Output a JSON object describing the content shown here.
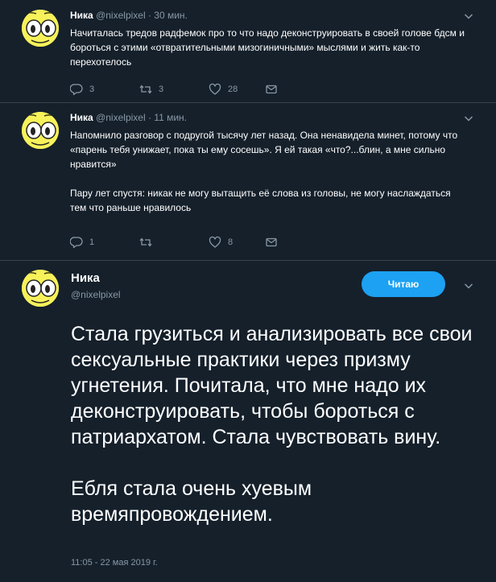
{
  "tweets": [
    {
      "name": "Ника",
      "handle": "@nixelpixel",
      "time": "· 30 мин.",
      "text": "Начиталась тредов радфемок про то что надо деконструировать в своей голове бдсм и бороться с этими «отвратительными мизогиничными» мыслями и жить как-то перехотелось",
      "replies": "3",
      "retweets": "3",
      "likes": "28"
    },
    {
      "name": "Ника",
      "handle": "@nixelpixel",
      "time": "· 11 мин.",
      "text1": "Напомнило разговор с подругой тысячу лет назад. Она ненавидела минет, потому что «парень тебя унижает, пока ты ему сосешь». Я ей такая «что?...блин, а мне сильно нравится»",
      "text2": "Пару лет спустя: никак не могу вытащить её слова из головы, не могу наслаждаться тем что раньше нравилось",
      "replies": "1",
      "retweets": "",
      "likes": "8"
    }
  ],
  "main_tweet": {
    "name": "Ника",
    "handle": "@nixelpixel",
    "follow_label": "Читаю",
    "text1": "Стала грузиться и анализировать все свои сексуальные практики через призму угнетения. Почитала, что мне надо их деконструировать, чтобы бороться с патриархатом. Стала чувствовать вину.",
    "text2": "Ебля стала очень хуевым времяпровождением.",
    "timestamp": "11:05 - 22 мая 2019 г."
  },
  "icons": {
    "reply": "reply-icon",
    "retweet": "retweet-icon",
    "like": "heart-icon",
    "dm": "direct-message-icon",
    "menu": "chevron-down-icon"
  },
  "colors": {
    "background": "#15202b",
    "divider": "#38444d",
    "muted": "#8899a6",
    "accent": "#1da1f2",
    "avatar": "#f7f25a"
  }
}
